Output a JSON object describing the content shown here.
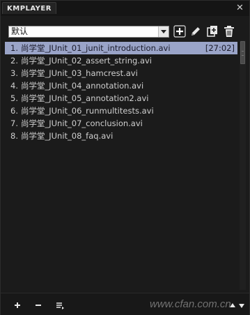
{
  "app": {
    "logo_text": "KMPLAYER",
    "close_glyph": "✕"
  },
  "toolbar": {
    "playlist_selector": {
      "selected": "默认"
    },
    "buttons": [
      {
        "name": "add",
        "icon": "plus-icon"
      },
      {
        "name": "edit",
        "icon": "pencil-icon"
      },
      {
        "name": "copy",
        "icon": "copy-icon"
      },
      {
        "name": "delete",
        "icon": "trash-icon"
      }
    ]
  },
  "playlist": {
    "items": [
      {
        "num": "1.",
        "title": "尚学堂_JUnit_01_junit_introduction.avi",
        "duration": "[27:02]",
        "selected": true
      },
      {
        "num": "2.",
        "title": "尚学堂_JUnit_02_assert_string.avi",
        "duration": "",
        "selected": false
      },
      {
        "num": "3.",
        "title": "尚学堂_JUnit_03_hamcrest.avi",
        "duration": "",
        "selected": false
      },
      {
        "num": "4.",
        "title": "尚学堂_JUnit_04_annotation.avi",
        "duration": "",
        "selected": false
      },
      {
        "num": "5.",
        "title": "尚学堂_JUnit_05_annotation2.avi",
        "duration": "",
        "selected": false
      },
      {
        "num": "6.",
        "title": "尚学堂_JUnit_06_runmultitests.avi",
        "duration": "",
        "selected": false
      },
      {
        "num": "7.",
        "title": "尚学堂_JUnit_07_conclusion.avi",
        "duration": "",
        "selected": false
      },
      {
        "num": "8.",
        "title": "尚学堂_JUnit_08_faq.avi",
        "duration": "",
        "selected": false
      }
    ]
  },
  "bottombar": {
    "buttons": [
      {
        "name": "add",
        "icon": "plus-icon"
      },
      {
        "name": "remove",
        "icon": "minus-icon"
      },
      {
        "name": "list-menu",
        "icon": "list-icon"
      },
      {
        "name": "move-up",
        "icon": "triangle-up-icon"
      },
      {
        "name": "move-down",
        "icon": "triangle-down-icon"
      }
    ],
    "watermark": "www.cfan.com.cn"
  },
  "colors": {
    "background": "#1b1b1b",
    "selected_row": "#9aa4c8",
    "text": "#cfcfcf"
  }
}
